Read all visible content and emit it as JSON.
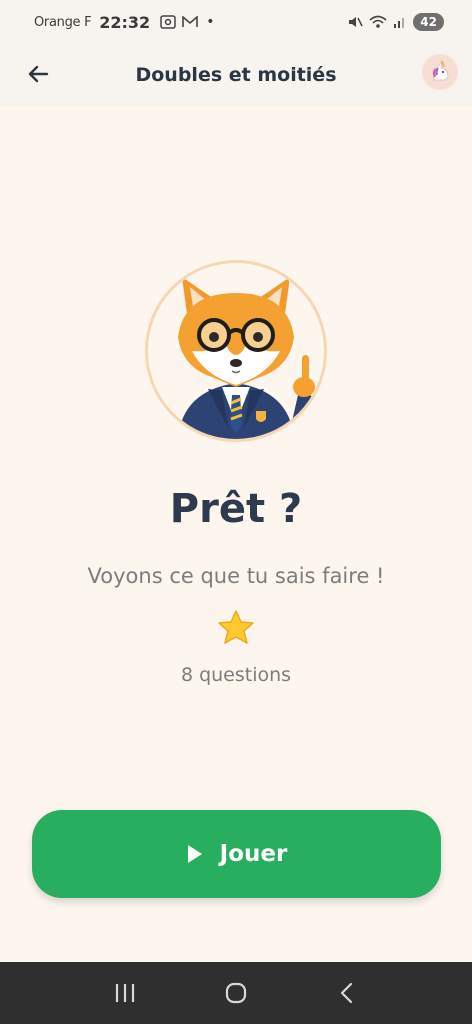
{
  "status_bar": {
    "carrier": "Orange F",
    "time": "22:32",
    "battery": "42",
    "dot": "•"
  },
  "header": {
    "title": "Doubles et moitiés",
    "back_icon": "arrow-left-icon",
    "avatar_icon": "unicorn-icon"
  },
  "main": {
    "mascot": "fox-teacher-mascot",
    "title": "Prêt ?",
    "subtitle": "Voyons ce que tu sais faire !",
    "star_icon": "star-icon",
    "question_count": "8 questions"
  },
  "play_button": {
    "label": "Jouer",
    "icon": "play-icon",
    "color": "#28ae5f"
  },
  "colors": {
    "background": "#fdf6ef",
    "header_bg": "#f7f3ef",
    "title": "#2e3a4d",
    "muted": "#7d7d7d",
    "nav_bar": "#2f2f2f"
  }
}
